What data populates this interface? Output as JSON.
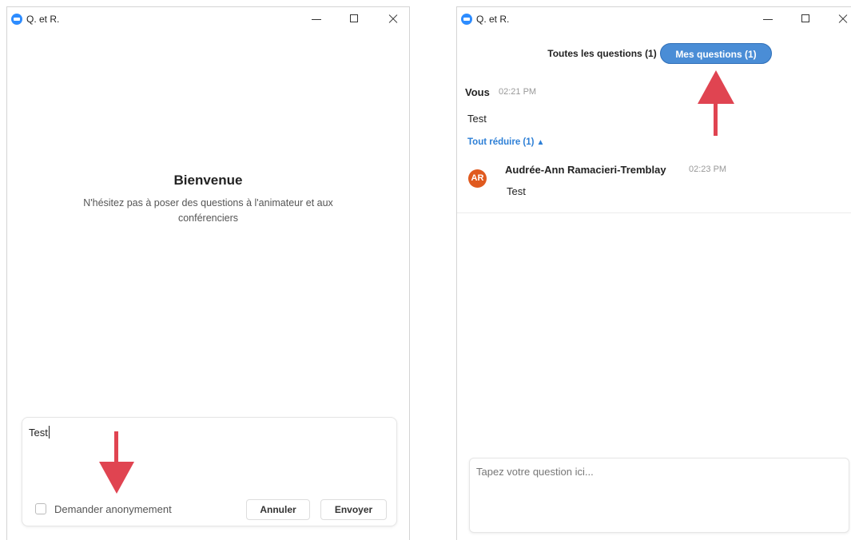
{
  "left_window": {
    "title": "Q. et R.",
    "welcome_title": "Bienvenue",
    "welcome_subtitle": "N'hésitez pas à poser des questions à l'animateur et aux conférenciers",
    "compose": {
      "value": "Test",
      "anonymous_label": "Demander anonymement",
      "cancel_label": "Annuler",
      "send_label": "Envoyer"
    }
  },
  "right_window": {
    "title": "Q. et R.",
    "tabs": {
      "all": "Toutes les questions (1)",
      "mine": "Mes questions (1)"
    },
    "question": {
      "author": "Vous",
      "time": "02:21 PM",
      "text": "Test"
    },
    "collapse_label": "Tout réduire (1)",
    "reply": {
      "avatar_initials": "AR",
      "author": "Audrée-Ann Ramacieri-Tremblay",
      "time": "02:23 PM",
      "text": "Test"
    },
    "compose_placeholder": "Tapez votre question ici..."
  },
  "colors": {
    "accent": "#4a8dd6",
    "link": "#2d7fd6",
    "avatar": "#e05a1f",
    "annotation_arrow": "#e04451"
  },
  "icons": {
    "app": "zoom-app-icon",
    "minimize": "minimize-icon",
    "maximize": "maximize-icon",
    "close": "close-icon",
    "collapse": "chevron-up-icon",
    "annotation": "arrow-icon"
  }
}
